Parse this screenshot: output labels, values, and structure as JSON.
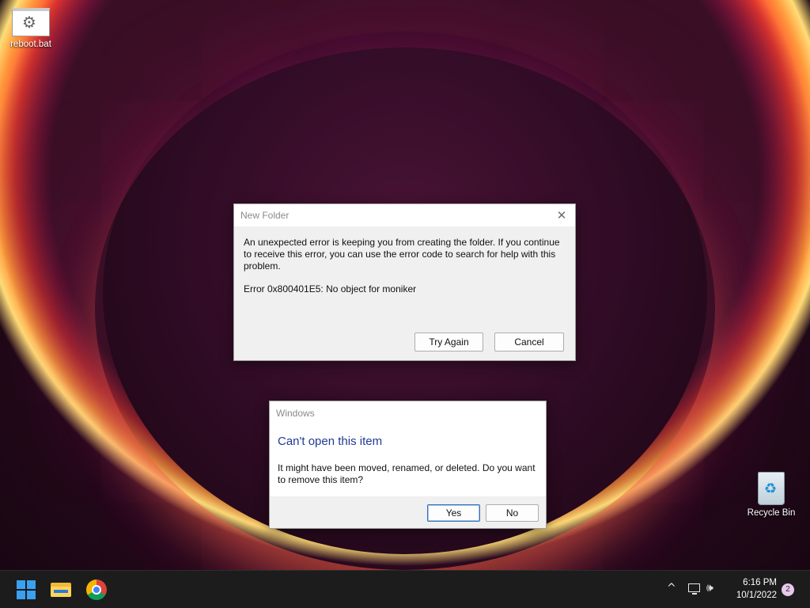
{
  "desktop": {
    "icons": [
      {
        "label": "reboot.bat",
        "icon": "gear-icon"
      },
      {
        "label": "Recycle Bin",
        "icon": "recycle-bin-icon"
      }
    ]
  },
  "dialog_new_folder": {
    "title": "New Folder",
    "message": "An unexpected error is keeping you from creating the folder. If you continue to receive this error, you can use the error code to search for help with this problem.",
    "error": "Error 0x800401E5: No object for moniker",
    "buttons": {
      "try_again": "Try Again",
      "cancel": "Cancel"
    },
    "close_glyph": "✕"
  },
  "dialog_windows": {
    "title": "Windows",
    "heading": "Can't open this item",
    "message": "It might have been moved, renamed, or deleted. Do you want to remove this item?",
    "buttons": {
      "yes": "Yes",
      "no": "No"
    }
  },
  "taskbar": {
    "apps": [
      "windows-start-icon",
      "file-explorer-icon",
      "chrome-icon"
    ],
    "tray": {
      "chevron": "^",
      "volume": "🕪",
      "time": "6:16 PM",
      "date": "10/1/2022",
      "notification_count": "2"
    }
  }
}
